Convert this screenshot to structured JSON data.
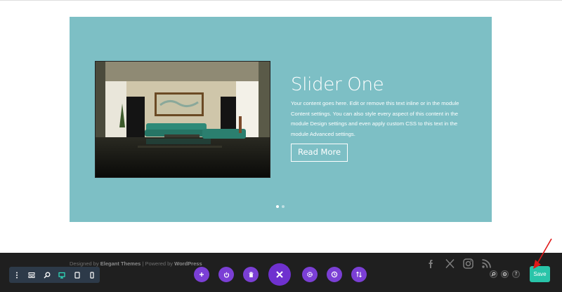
{
  "colors": {
    "slider_background": "#7dbfc5",
    "footer_background": "#1f1f1f",
    "toolbar_background": "#2d3a49",
    "builder_purple": "#7b3fd5",
    "save_green": "#29c4a9",
    "annotation_arrow": "#e01818"
  },
  "slider": {
    "title": "Slider One",
    "description": "Your content goes here. Edit or remove this text inline or in the module Content settings. You can also style every aspect of this content in the module Design settings and even apply custom CSS to this text in the module Advanced settings.",
    "button_label": "Read More",
    "image_icon": "living-room-photo",
    "active_slide": 1,
    "slide_count": 2
  },
  "footer": {
    "credits_prefix": "Designed by",
    "credits_brand": "Elegant Themes",
    "credits_separator": "| Powered by",
    "credits_platform": "WordPress",
    "social_icons": [
      "facebook-icon",
      "x-icon",
      "instagram-icon",
      "rss-icon"
    ]
  },
  "builder": {
    "left_toolbar_icons": [
      "more-options-icon",
      "wireframe-icon",
      "zoom-icon",
      "desktop-icon",
      "tablet-icon",
      "phone-icon"
    ],
    "active_view": "desktop-icon",
    "center_buttons": [
      "add-icon",
      "power-icon",
      "trash-icon",
      "close-icon",
      "settings-icon",
      "history-icon",
      "portability-icon"
    ],
    "right_icons": [
      "search-icon",
      "layers-icon",
      "help-icon"
    ],
    "help_glyph": "?",
    "save_label": "Save"
  }
}
